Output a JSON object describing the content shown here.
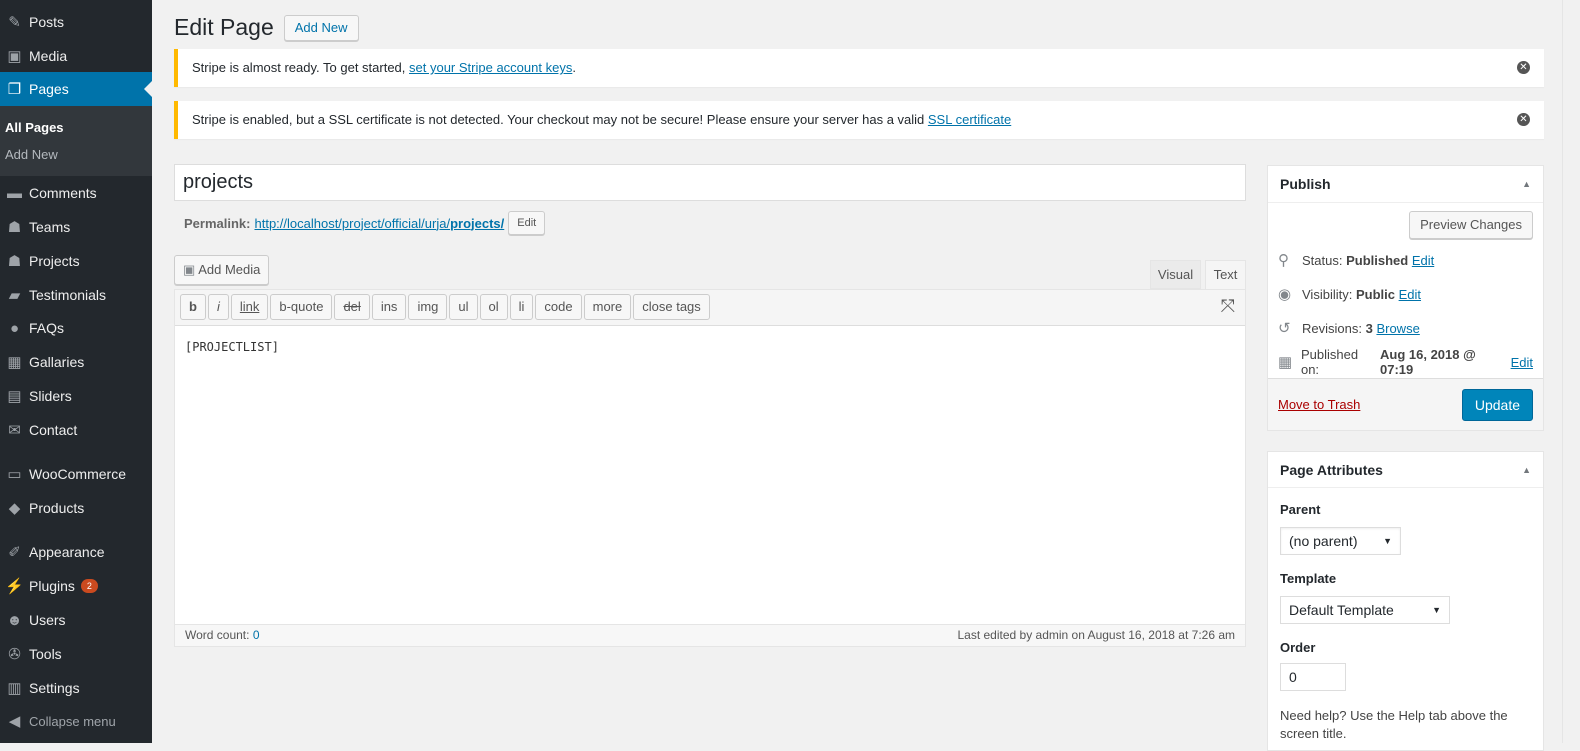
{
  "sidebar": {
    "items": [
      {
        "label": "Posts",
        "icon": "pin-icon",
        "glyph": "✎"
      },
      {
        "label": "Media",
        "icon": "media-icon",
        "glyph": "▣"
      },
      {
        "label": "Pages",
        "icon": "pages-icon",
        "glyph": "❐"
      },
      {
        "label": "Comments",
        "icon": "comment-icon",
        "glyph": "▬"
      },
      {
        "label": "Teams",
        "icon": "groups-icon",
        "glyph": "☗"
      },
      {
        "label": "Projects",
        "icon": "groups-icon",
        "glyph": "☗"
      },
      {
        "label": "Testimonials",
        "icon": "testimonial-icon",
        "glyph": "▰"
      },
      {
        "label": "FAQs",
        "icon": "faq-icon",
        "glyph": "●"
      },
      {
        "label": "Gallaries",
        "icon": "gallery-icon",
        "glyph": "▦"
      },
      {
        "label": "Sliders",
        "icon": "slides-icon",
        "glyph": "▤"
      },
      {
        "label": "Contact",
        "icon": "email-icon",
        "glyph": "✉"
      },
      {
        "label": "WooCommerce",
        "icon": "woo-icon",
        "glyph": "▭"
      },
      {
        "label": "Products",
        "icon": "archive-icon",
        "glyph": "◆"
      },
      {
        "label": "Appearance",
        "icon": "brush-icon",
        "glyph": "✐"
      },
      {
        "label": "Plugins",
        "icon": "plugin-icon",
        "glyph": "⚡",
        "badge": "2"
      },
      {
        "label": "Users",
        "icon": "user-icon",
        "glyph": "☻"
      },
      {
        "label": "Tools",
        "icon": "wrench-icon",
        "glyph": "✇"
      },
      {
        "label": "Settings",
        "icon": "settings-icon",
        "glyph": "▥"
      },
      {
        "label": "Collapse menu",
        "icon": "collapse-icon",
        "glyph": "◀"
      }
    ],
    "submenu": [
      "All Pages",
      "Add New"
    ],
    "active_color": "#0073aa"
  },
  "header": {
    "title": "Edit Page",
    "add_new": "Add New"
  },
  "notices": [
    {
      "text": "Stripe is almost ready. To get started, ",
      "link": "set your Stripe account keys",
      "after": "."
    },
    {
      "text": "Stripe is enabled, but a SSL certificate is not detected. Your checkout may not be secure! Please ensure your server has a valid ",
      "link": "SSL certificate",
      "after": ""
    }
  ],
  "post": {
    "title": "projects",
    "permalink_label": "Permalink:",
    "permalink_base": "http://localhost/project/official/urja/",
    "permalink_slug": "projects/",
    "edit": "Edit"
  },
  "editor": {
    "add_media": "Add Media",
    "tabs": [
      "Visual",
      "Text"
    ],
    "active_tab": "Text",
    "buttons": [
      "b",
      "i",
      "link",
      "b-quote",
      "del",
      "ins",
      "img",
      "ul",
      "ol",
      "li",
      "code",
      "more",
      "close tags"
    ],
    "content": "[PROJECTLIST]",
    "word_count_label": "Word count:",
    "word_count": "0",
    "last_edited": "Last edited by admin on August 16, 2018 at 7:26 am"
  },
  "publish": {
    "title": "Publish",
    "preview": "Preview Changes",
    "status_label": "Status:",
    "status": "Published",
    "visibility_label": "Visibility:",
    "visibility": "Public",
    "revisions_label": "Revisions:",
    "revisions": "3",
    "browse": "Browse",
    "published_label": "Published on:",
    "published": "Aug 16, 2018 @ 07:19",
    "edit": "Edit",
    "trash": "Move to Trash",
    "update": "Update"
  },
  "attributes": {
    "title": "Page Attributes",
    "parent_label": "Parent",
    "parent": "(no parent)",
    "template_label": "Template",
    "template": "Default Template",
    "order_label": "Order",
    "order": "0",
    "help": "Need help? Use the Help tab above the screen title."
  }
}
